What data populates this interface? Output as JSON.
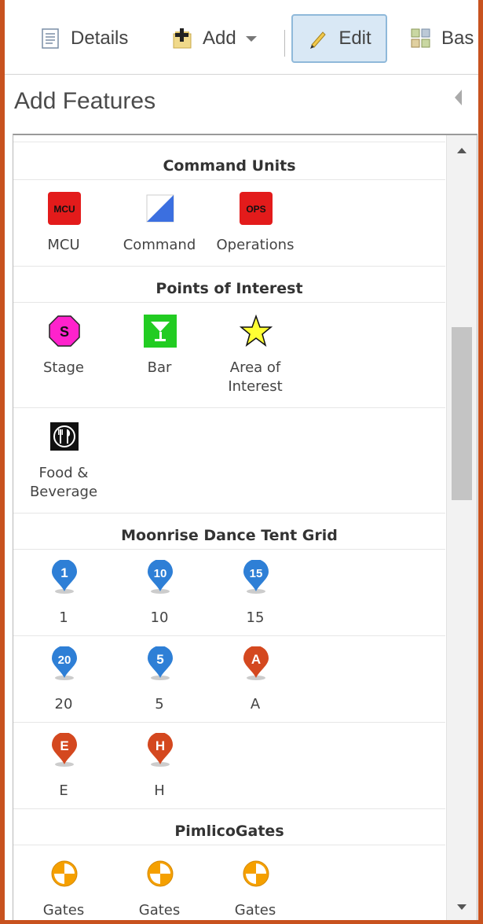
{
  "toolbar": {
    "details_label": "Details",
    "add_label": "Add",
    "edit_label": "Edit",
    "basemap_label": "Bas"
  },
  "panel": {
    "title": "Add Features"
  },
  "groups": {
    "command_units": {
      "title": "Command Units",
      "items": [
        {
          "label": "MCU",
          "icon_text": "MCU",
          "icon": "red-box-icon",
          "color": "#e31b1b"
        },
        {
          "label": "Command",
          "icon": "command-triangle-icon",
          "color": "#3b6fe0"
        },
        {
          "label": "Operations",
          "icon_text": "OPS",
          "icon": "red-box-icon",
          "color": "#e31b1b"
        }
      ]
    },
    "points_of_interest": {
      "title": "Points of Interest",
      "items": [
        {
          "label": "Stage",
          "icon_text": "S",
          "icon": "stage-octagon-icon",
          "color": "#ff22cc"
        },
        {
          "label": "Bar",
          "icon": "cocktail-glass-icon",
          "color": "#22cc22"
        },
        {
          "label": "Area of\nInterest",
          "label_line1": "Area of",
          "label_line2": "Interest",
          "icon": "star-icon",
          "color": "#ffff33"
        },
        {
          "label": "Food &\nBeverage",
          "label_line1": "Food &",
          "label_line2": "Beverage",
          "icon": "cutlery-icon",
          "color": "#111111"
        }
      ]
    },
    "dance_tent_grid": {
      "title": "Moonrise Dance Tent Grid",
      "items": [
        {
          "label": "1",
          "pin_text": "1",
          "color": "#2e7fd6"
        },
        {
          "label": "10",
          "pin_text": "10",
          "color": "#2e7fd6"
        },
        {
          "label": "15",
          "pin_text": "15",
          "color": "#2e7fd6"
        },
        {
          "label": "20",
          "pin_text": "20",
          "color": "#2e7fd6"
        },
        {
          "label": "5",
          "pin_text": "5",
          "color": "#2e7fd6"
        },
        {
          "label": "A",
          "pin_text": "A",
          "color": "#d4481f"
        },
        {
          "label": "E",
          "pin_text": "E",
          "color": "#d4481f"
        },
        {
          "label": "H",
          "pin_text": "H",
          "color": "#d4481f"
        }
      ]
    },
    "pimlico_gates": {
      "title": "PimlicoGates",
      "items": [
        {
          "label": "Gates",
          "icon": "gate-circle-icon",
          "color": "#f5a000"
        },
        {
          "label": "Gates",
          "icon": "gate-circle-icon",
          "color": "#f5a000"
        },
        {
          "label": "Gates",
          "icon": "gate-circle-icon",
          "color": "#f5a000"
        }
      ]
    }
  }
}
